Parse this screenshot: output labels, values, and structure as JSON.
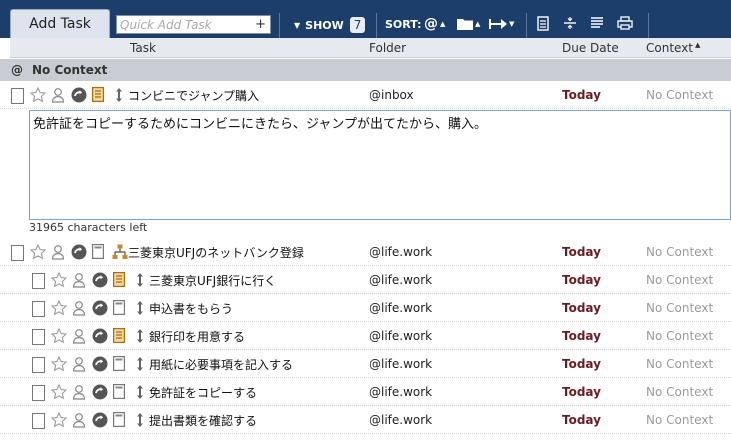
{
  "toolbar": {
    "add_task_label": "Add Task",
    "quick_add_placeholder": "Quick Add Task",
    "quick_add_plus": "+",
    "show_label": "SHOW",
    "show_count": "7",
    "sort_label": "SORT:",
    "colors": {
      "background": "#1c3e6b",
      "text": "#ffffff"
    }
  },
  "columns": {
    "task": "Task",
    "folder": "Folder",
    "due": "Due Date",
    "context": "Context"
  },
  "group": {
    "icon": "@",
    "label": "No Context"
  },
  "note": {
    "text": "免許証をコピーするためにコンビニにきたら、ジャンプが出てたから、購入。",
    "chars_left": "31965 characters left"
  },
  "tasks": [
    {
      "title": "コンビニでジャンプ購入",
      "folder": "@inbox",
      "due": "Today",
      "context": "No Context"
    },
    {
      "title": "三菱東京UFJのネットバンク登録",
      "folder": "@life.work",
      "due": "Today",
      "context": "No Context"
    },
    {
      "title": "三菱東京UFJ銀行に行く",
      "folder": "@life.work",
      "due": "Today",
      "context": "No Context"
    },
    {
      "title": "申込書をもらう",
      "folder": "@life.work",
      "due": "Today",
      "context": "No Context"
    },
    {
      "title": "銀行印を用意する",
      "folder": "@life.work",
      "due": "Today",
      "context": "No Context"
    },
    {
      "title": "用紙に必要事項を記入する",
      "folder": "@life.work",
      "due": "Today",
      "context": "No Context"
    },
    {
      "title": "免許証をコピーする",
      "folder": "@life.work",
      "due": "Today",
      "context": "No Context"
    },
    {
      "title": "提出書類を確認する",
      "folder": "@life.work",
      "due": "Today",
      "context": "No Context"
    }
  ],
  "colors": {
    "due_today": "#6b1d24",
    "context_muted": "#9a9a9a",
    "group_bg": "#c9ccd2",
    "header_bg": "#e6e9ee"
  }
}
